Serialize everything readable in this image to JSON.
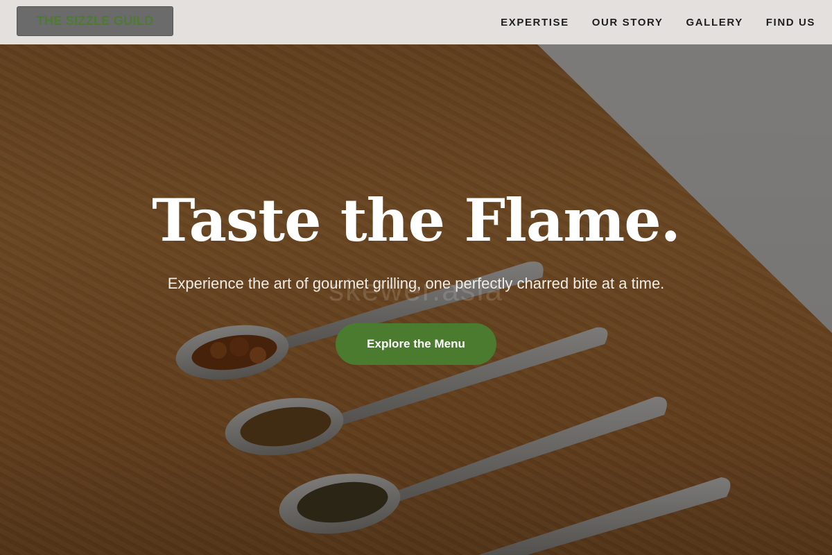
{
  "header": {
    "logo_text": "THE SIZZLE GUILD",
    "nav": [
      {
        "label": "EXPERTISE"
      },
      {
        "label": "OUR STORY"
      },
      {
        "label": "GALLERY"
      },
      {
        "label": "FIND US"
      }
    ]
  },
  "hero": {
    "title": "Taste the Flame.",
    "subtitle": "Experience the art of gourmet grilling, one perfectly charred bite at a time.",
    "watermark": "skewer.asia",
    "cta_label": "Explore the Menu"
  },
  "colors": {
    "accent": "#4a7b2e",
    "header_bg": "#e3e0de",
    "logo_text": "#4d7c2f"
  },
  "icons": [
    "spoon-with-dried-spice",
    "spoon-with-dried-herbs",
    "spoon-with-seeds",
    "empty-spoon"
  ]
}
